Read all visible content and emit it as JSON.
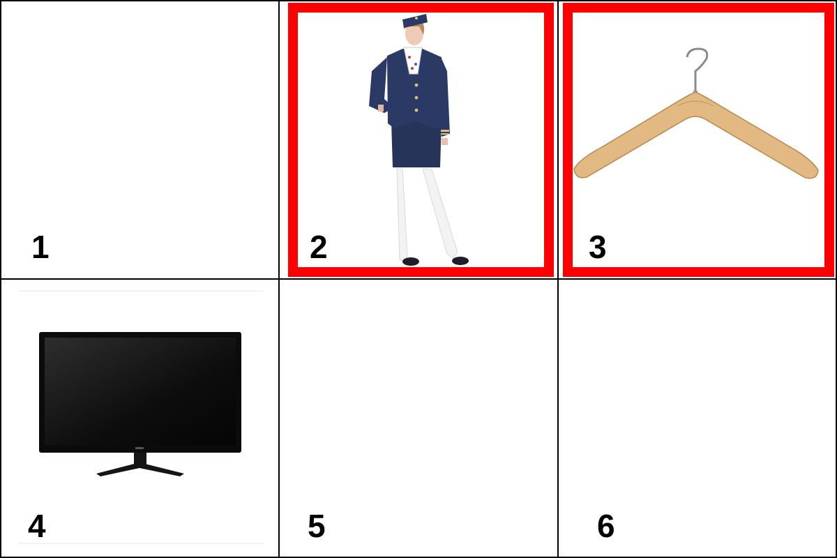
{
  "tiles": [
    {
      "label": "1",
      "content": "empty",
      "selected": false
    },
    {
      "label": "2",
      "content": "flight-attendant-image",
      "selected": true
    },
    {
      "label": "3",
      "content": "coat-hanger-image",
      "selected": true
    },
    {
      "label": "4",
      "content": "computer-monitor-image",
      "selected": false
    },
    {
      "label": "5",
      "content": "empty",
      "selected": false
    },
    {
      "label": "6",
      "content": "empty",
      "selected": false
    }
  ],
  "colors": {
    "grid_lines": "#000000",
    "selection_border": "#ff0000",
    "background": "#ffffff"
  }
}
